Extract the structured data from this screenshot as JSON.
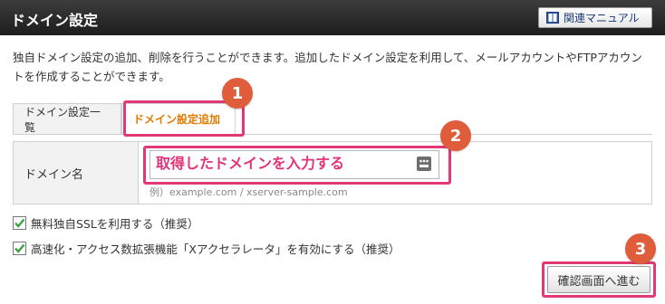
{
  "header": {
    "title": "ドメイン設定",
    "manual_button": "関連マニュアル"
  },
  "description": "独自ドメイン設定の追加、削除を行うことができます。追加したドメイン設定を利用して、メールアカウントやFTPアカウントを作成することができます。",
  "tabs": [
    {
      "label": "ドメイン設定一覧"
    },
    {
      "label": "ドメイン設定追加"
    }
  ],
  "form": {
    "domain_label": "ドメイン名",
    "domain_placeholder": "取得したドメインを入力する",
    "domain_example": "例）example.com / xserver-sample.com"
  },
  "options": {
    "ssl_label": "無料独自SSLを利用する（推奨）",
    "accelerator_label": "高速化・アクセス数拡張機能「Xアクセラレータ」を有効にする（推奨）"
  },
  "confirm_button": "確認画面へ進む",
  "callouts": {
    "badge1": "1",
    "badge2": "2",
    "badge3": "3"
  },
  "colors": {
    "header_bg": "#2b2b2b",
    "active_tab": "#e07b00",
    "callout_border": "#e33878",
    "badge": "#df5d3a",
    "checkbox_green": "#3aa63a"
  }
}
